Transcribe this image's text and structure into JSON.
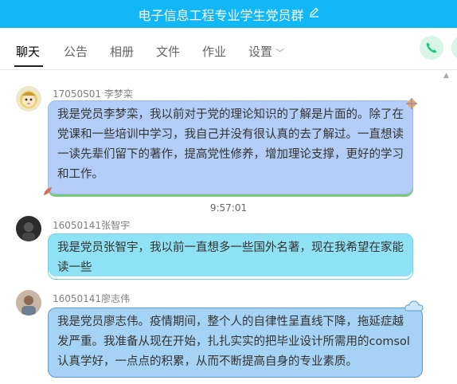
{
  "window": {
    "title": "电子信息工程专业学生党员群"
  },
  "tabs": [
    {
      "label": "聊天",
      "active": true
    },
    {
      "label": "公告",
      "active": false
    },
    {
      "label": "相册",
      "active": false
    },
    {
      "label": "文件",
      "active": false
    },
    {
      "label": "作业",
      "active": false
    },
    {
      "label": "设置",
      "active": false
    }
  ],
  "colors": {
    "titlebar": "#12b7f5",
    "call_button": "#1fc57f",
    "bubble1": "#b3cdf6",
    "bubble2": "#8fe2f4",
    "bubble3": "#a6d3f3"
  },
  "icons": {
    "edit": "pencil-icon",
    "call": "phone-icon",
    "settings_dropdown": "chevron-down-icon"
  },
  "messages": [
    {
      "sender": "17050S01 李梦栾",
      "text": "我是党员李梦栾，我以前对于党的理论知识的了解是片面的。除了在党课和一些培训中学习，我自己并没有很认真的去了解过。一直想读一读先辈们留下的著作，提高党性修养，增加理论支撑，更好的学习和工作。"
    },
    {
      "time": "9:57:01"
    },
    {
      "sender": "16050141张智宇",
      "text": "我是党员张智宇，我以前一直想多一些国外名著，现在我希望在家能读一些"
    },
    {
      "sender": "16050141廖志伟",
      "text": "我是党员廖志伟。疫情期间，整个人的自律性呈直线下降，拖延症越发严重。我准备从现在开始，扎扎实实的把毕业设计所需用的comsol认真学好，一点点的积累，从而不断提高自身的专业素质。"
    }
  ]
}
